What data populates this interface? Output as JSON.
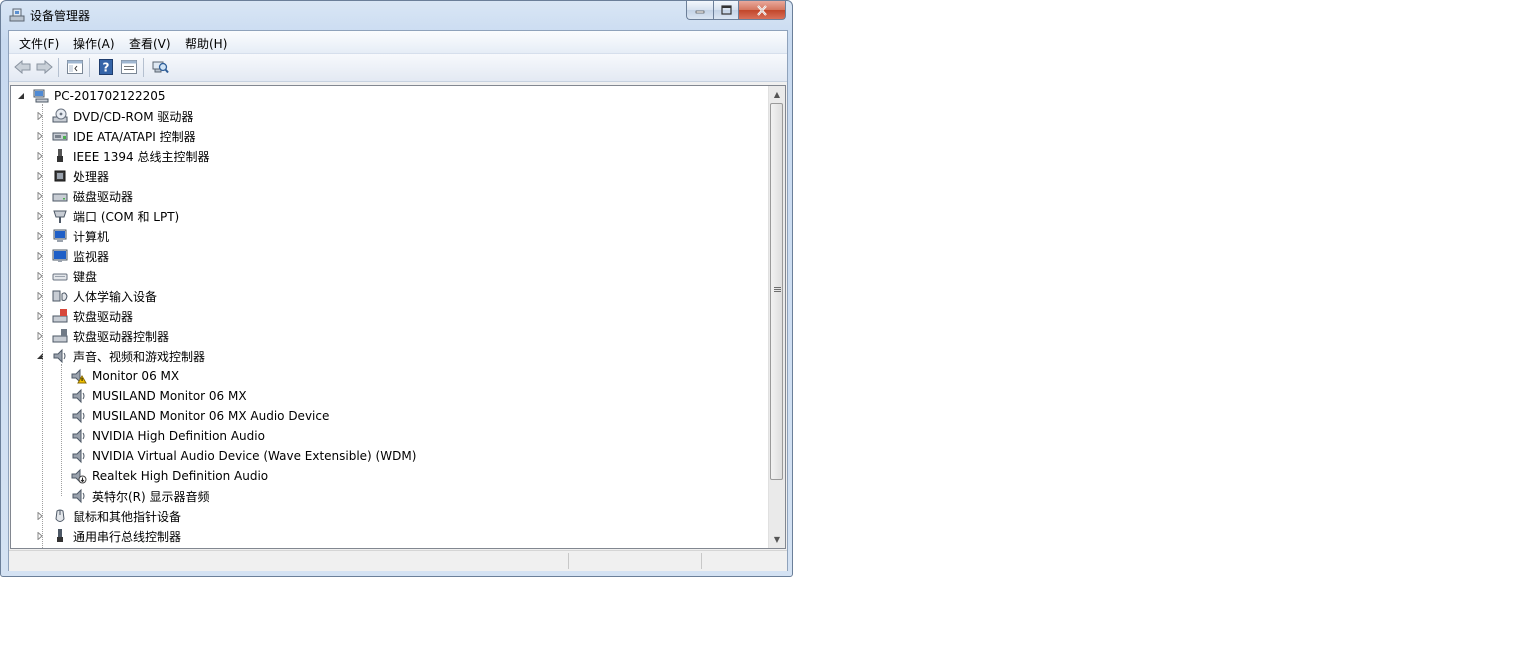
{
  "window": {
    "title": "设备管理器"
  },
  "menu": [
    "文件(F)",
    "操作(A)",
    "查看(V)",
    "帮助(H)"
  ],
  "toolbar": [
    "back-icon",
    "forward-icon",
    "show-hide-console-tree-icon",
    "help-icon",
    "properties-icon",
    "scan-hardware-icon"
  ],
  "tree": {
    "root": "PC-201702122205",
    "categories": [
      {
        "label": "DVD/CD-ROM 驱动器",
        "icon": "dvd-drive-icon"
      },
      {
        "label": "IDE ATA/ATAPI 控制器",
        "icon": "ide-controller-icon"
      },
      {
        "label": "IEEE 1394 总线主控制器",
        "icon": "ieee1394-icon"
      },
      {
        "label": "处理器",
        "icon": "processor-icon"
      },
      {
        "label": "磁盘驱动器",
        "icon": "disk-drive-icon"
      },
      {
        "label": "端口 (COM 和 LPT)",
        "icon": "port-icon"
      },
      {
        "label": "计算机",
        "icon": "computer-icon"
      },
      {
        "label": "监视器",
        "icon": "monitor-icon"
      },
      {
        "label": "键盘",
        "icon": "keyboard-icon"
      },
      {
        "label": "人体学输入设备",
        "icon": "hid-icon"
      },
      {
        "label": "软盘驱动器",
        "icon": "floppy-drive-icon"
      },
      {
        "label": "软盘驱动器控制器",
        "icon": "floppy-controller-icon"
      },
      {
        "label": "声音、视频和游戏控制器",
        "icon": "speaker-icon"
      }
    ],
    "sound_children": [
      {
        "label": "Monitor 06 MX",
        "icon": "speaker-warning-icon"
      },
      {
        "label": "MUSILAND Monitor 06 MX",
        "icon": "speaker-icon"
      },
      {
        "label": "MUSILAND Monitor 06 MX Audio Device",
        "icon": "speaker-icon"
      },
      {
        "label": "NVIDIA High Definition Audio",
        "icon": "speaker-icon"
      },
      {
        "label": "NVIDIA Virtual Audio Device (Wave Extensible) (WDM)",
        "icon": "speaker-icon"
      },
      {
        "label": "Realtek High Definition Audio",
        "icon": "speaker-disabled-icon"
      },
      {
        "label": "英特尔(R) 显示器音频",
        "icon": "speaker-icon"
      }
    ],
    "after": [
      {
        "label": "鼠标和其他指针设备",
        "icon": "mouse-icon"
      },
      {
        "label": "通用串行总线控制器",
        "icon": "usb-icon"
      }
    ]
  }
}
